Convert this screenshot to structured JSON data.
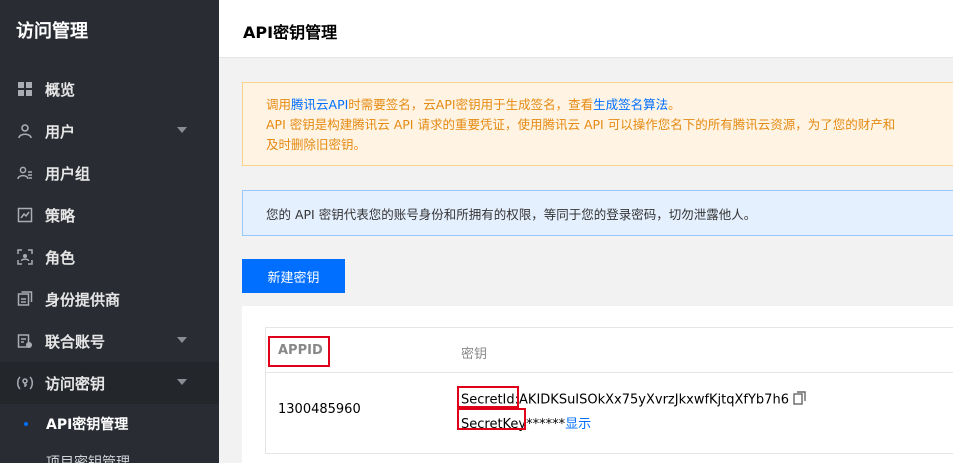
{
  "sidebar": {
    "title": "访问管理",
    "items": [
      {
        "label": "概览",
        "icon": "grid-icon"
      },
      {
        "label": "用户",
        "icon": "user-icon",
        "chevron": true
      },
      {
        "label": "用户组",
        "icon": "user-group-icon"
      },
      {
        "label": "策略",
        "icon": "policy-icon"
      },
      {
        "label": "角色",
        "icon": "role-icon"
      },
      {
        "label": "身份提供商",
        "icon": "identity-provider-icon"
      },
      {
        "label": "联合账号",
        "icon": "federated-account-icon",
        "chevron": true
      },
      {
        "label": "访问密钥",
        "icon": "key-icon",
        "chevron": true
      }
    ],
    "subitems": [
      {
        "label": "API密钥管理",
        "active": true
      },
      {
        "label": "项目密钥管理",
        "active": false
      }
    ]
  },
  "header": {
    "title": "API密钥管理"
  },
  "warning": {
    "line1_pre": "调用",
    "line1_link1": "腾讯云API",
    "line1_mid": "时需要签名，云API密钥用于生成签名，查看",
    "line1_link2": "生成签名算法",
    "line1_post": "。",
    "line2": "API 密钥是构建腾讯云 API 请求的重要凭证，使用腾讯云 API 可以操作您名下的所有腾讯云资源，为了您的财产和",
    "line3": "及时删除旧密钥。"
  },
  "info": {
    "text": "您的 API 密钥代表您的账号身份和所拥有的权限，等同于您的登录密码，切勿泄露他人。"
  },
  "actions": {
    "new_key": "新建密钥"
  },
  "table": {
    "headers": {
      "appid": "APPID",
      "key": "密钥"
    },
    "rows": [
      {
        "appid": "1300485960",
        "secret_id_label": "SecretId:",
        "secret_id_value": "AKIDKSuISOkXx75yXvrzJkxwfKjtqXfYb7h6",
        "secret_key_label": "SecretKey",
        "secret_key_value": "******",
        "show_label": "显示"
      }
    ]
  },
  "colors": {
    "primary": "#006eff",
    "sidebar_bg": "#292d33",
    "highlight": "#e0001a"
  }
}
